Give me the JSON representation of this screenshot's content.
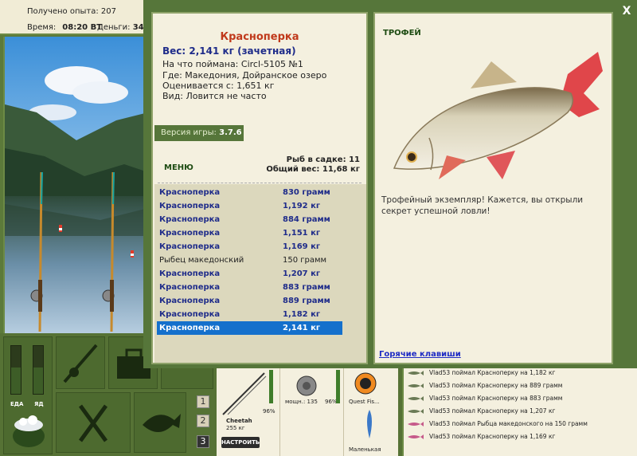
{
  "top_bar": {
    "experience": "Получено опыта: 207",
    "time_label": "Время:",
    "time_value": "08:20 ВТ",
    "money_label": "Деньги:",
    "money_value": "34"
  },
  "gauges": {
    "food_label": "ЕДА",
    "poison_label": "ЯД",
    "food_level": 0.55,
    "poison_level": 0.55
  },
  "level_buttons": [
    "1",
    "2",
    "3"
  ],
  "tackle": {
    "rod_name": "Cheetah",
    "rod_weight": "255 кг",
    "rod_percent": "96%",
    "reel_label": "мощн.: 135",
    "reel_percent": "96%",
    "line_label": "Quest Fis...",
    "lure_label": "Маленькая",
    "setup_button": "НАСТРОИТЬ"
  },
  "chat": [
    "Vlad53 поймал Красноперку на 1,182 кг",
    "Vlad53 поймал Красноперку на 889 грамм",
    "Vlad53 поймал Красноперку на 883 грамм",
    "Vlad53 поймал Красноперку на 1,207 кг",
    "Vlad53 поймал Рыбца македонского на 150 грамм",
    "Vlad53 поймал Красноперку на 1,169 кг"
  ],
  "dialog": {
    "close": "X",
    "fish_name": "Красноперка",
    "weight_line": "Вес: 2,141 кг (зачетная)",
    "caught_on": "На что поймана: Circl-5105 №1",
    "location": "Где: Македония, Дойранское озеро",
    "valued_from": "Оценивается с: 1,651 кг",
    "kind": "Вид: Ловится не часто",
    "version_label": "Версия игры:",
    "version_value": "3.7.6",
    "menu": "МЕНЮ",
    "keep_count": "Рыб в садке: 11",
    "keep_weight": "Общий вес: 11,68 кг",
    "trophy": "ТРОФЕЙ",
    "trophy_message": "Трофейный экземпляр! Кажется, вы открыли секрет успешной ловли!",
    "hotkeys": "Горячие клавиши"
  },
  "catch_list": [
    {
      "name": "Красноперка",
      "weight": "830 грамм",
      "style": "trophy"
    },
    {
      "name": "Красноперка",
      "weight": "1,192 кг",
      "style": "trophy"
    },
    {
      "name": "Красноперка",
      "weight": "884 грамм",
      "style": "trophy"
    },
    {
      "name": "Красноперка",
      "weight": "1,151 кг",
      "style": "trophy"
    },
    {
      "name": "Красноперка",
      "weight": "1,169 кг",
      "style": "trophy"
    },
    {
      "name": "Рыбец македонский",
      "weight": "150 грамм",
      "style": "normal"
    },
    {
      "name": "Красноперка",
      "weight": "1,207 кг",
      "style": "trophy"
    },
    {
      "name": "Красноперка",
      "weight": "883 грамм",
      "style": "trophy"
    },
    {
      "name": "Красноперка",
      "weight": "889 грамм",
      "style": "trophy"
    },
    {
      "name": "Красноперка",
      "weight": "1,182 кг",
      "style": "trophy"
    },
    {
      "name": "Красноперка",
      "weight": "2,141 кг",
      "style": "selected"
    }
  ],
  "colors": {
    "frame_green": "#56763a",
    "panel_bg": "#f4f0df",
    "title_red": "#c0391b",
    "trophy_blue": "#1f2c8a",
    "selection_blue": "#1470cc"
  }
}
